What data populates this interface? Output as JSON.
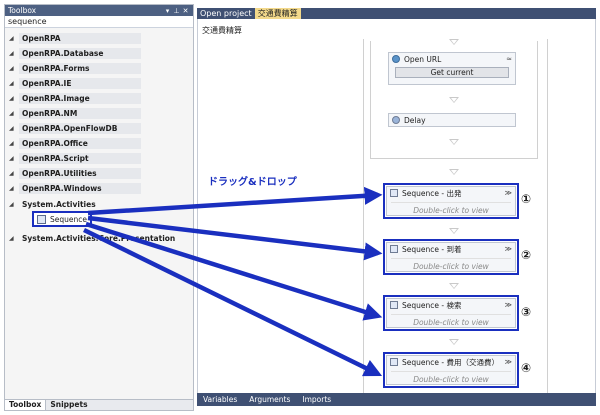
{
  "toolbox": {
    "title": "Toolbox",
    "pin_icon": "pin-icon",
    "close_icon": "close-icon",
    "search_value": "sequence",
    "categories": [
      "OpenRPA",
      "OpenRPA.Database",
      "OpenRPA.Forms",
      "OpenRPA.IE",
      "OpenRPA.Image",
      "OpenRPA.NM",
      "OpenRPA.OpenFlowDB",
      "OpenRPA.Office",
      "OpenRPA.Script",
      "OpenRPA.Utilities",
      "OpenRPA.Windows",
      "System.Activities",
      "System.Activities.Core.Presentation"
    ],
    "sequence_item": "Sequence",
    "bottom_tabs": [
      "Toolbox",
      "Snippets"
    ]
  },
  "document_tabs": [
    "Open project",
    "交通費精算"
  ],
  "designer": {
    "breadcrumb": "交通費精算",
    "open_url": {
      "title": "Open URL",
      "button": "Get current"
    },
    "delay": {
      "title": "Delay"
    },
    "drag_label": "ドラッグ&ドロップ",
    "sequences": [
      {
        "title": "Sequence - 出発",
        "hint": "Double-click to view",
        "marker": "①"
      },
      {
        "title": "Sequence - 到着",
        "hint": "Double-click to view",
        "marker": "②"
      },
      {
        "title": "Sequence - 検索",
        "hint": "Double-click to view",
        "marker": "③"
      },
      {
        "title": "Sequence - 費用（交通費）",
        "hint": "Double-click to view",
        "marker": "④"
      }
    ],
    "footer_tabs": [
      "Variables",
      "Arguments",
      "Imports"
    ]
  },
  "colors": {
    "highlight": "#1a2fbf",
    "titlebar": "#3f5073",
    "active_tab": "#f3d98b"
  }
}
